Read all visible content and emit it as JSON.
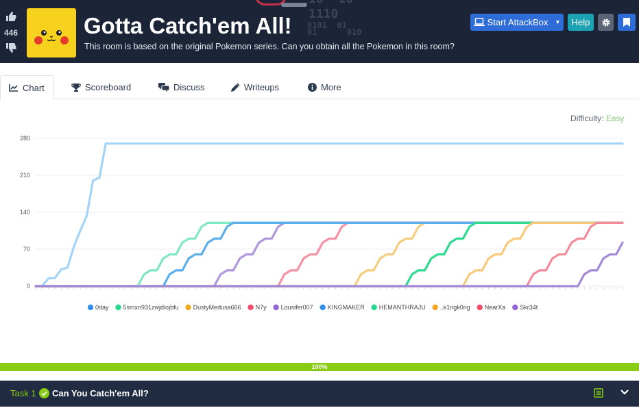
{
  "room": {
    "title": "Gotta Catch'em All!",
    "subtitle": "This room is based on the original Pokemon series. Can you obtain all the Pokemon in this room?",
    "votes": "446",
    "deco_lines": [
      "10  10",
      "1110",
      "0101  01",
      "01      010"
    ],
    "icon": "pikachu-face"
  },
  "header_buttons": {
    "attackbox_label": "Start AttackBox",
    "help_label": "Help",
    "settings_icon": "gear-icon",
    "bookmark_icon": "bookmark-icon"
  },
  "tabs": [
    {
      "label": "Chart",
      "icon": "chart-line-icon"
    },
    {
      "label": "Scoreboard",
      "icon": "trophy-icon"
    },
    {
      "label": "Discuss",
      "icon": "comments-icon"
    },
    {
      "label": "Writeups",
      "icon": "pen-icon"
    },
    {
      "label": "More",
      "icon": "info-icon"
    }
  ],
  "difficulty": {
    "label": "Difficulty:",
    "value": "Easy",
    "color": "#8cc97a"
  },
  "chart_data": {
    "type": "line",
    "title": "",
    "xlabel": "",
    "ylabel": "",
    "ylim": [
      0,
      280
    ],
    "yticks": [
      0,
      70,
      140,
      210,
      280
    ],
    "grid": true,
    "legend_position": "bottom",
    "series": [
      {
        "name": "0day",
        "color": "#a3d4f7",
        "start": 0.4,
        "end": 270,
        "steps": [
          0,
          15,
          35,
          105,
          200,
          270
        ],
        "ramp_start_index": 1
      },
      {
        "name": "5smxn931zwjdiojbfu",
        "color": "#7fe8c3",
        "start": 0,
        "end": 120,
        "steps": [
          0,
          30,
          60,
          90,
          120
        ],
        "ramp_start_index": 16
      },
      {
        "name": "DustyMedusa666",
        "color": "#f5cd7f",
        "start": 0,
        "end": 120,
        "steps": [
          0,
          30,
          60,
          90,
          120
        ],
        "ramp_start_index": 50
      },
      {
        "name": "N7y",
        "color": "#f492a4",
        "start": 0,
        "end": 120,
        "steps": [
          0,
          30,
          60,
          90,
          120
        ],
        "ramp_start_index": 38
      },
      {
        "name": "Lousifer007",
        "color": "#b097de",
        "start": 0,
        "end": 120,
        "steps": [
          0,
          30,
          60,
          90,
          120
        ],
        "ramp_start_index": 28
      },
      {
        "name": "KINGMAKER",
        "color": "#5aaeec",
        "start": 0,
        "end": 120,
        "steps": [
          0,
          30,
          60,
          90,
          120
        ],
        "ramp_start_index": 20
      },
      {
        "name": "HEMANTHRAJU",
        "color": "#2fd98d",
        "start": 0,
        "end": 120,
        "steps": [
          0,
          30,
          60,
          90,
          120
        ],
        "ramp_start_index": 58
      },
      {
        "name": "..k1ngk0ng",
        "color": "#f9c97b",
        "start": 0,
        "end": 120,
        "steps": [
          0,
          30,
          60,
          90,
          120
        ],
        "ramp_start_index": 67
      },
      {
        "name": "NearXa",
        "color": "#f48b9a",
        "start": 0,
        "end": 120,
        "steps": [
          0,
          30,
          60,
          90,
          120
        ],
        "ramp_start_index": 77
      },
      {
        "name": "Skr34t",
        "color": "#a38ad8",
        "start": 0,
        "end": 120,
        "steps": [
          0,
          30,
          60,
          90,
          120
        ],
        "ramp_start_index": 85
      }
    ],
    "x_count": 93,
    "legend_dot_colors": [
      "#2f91ec",
      "#29d68e",
      "#f3a823",
      "#f24d6b",
      "#9367d6",
      "#2f91ec",
      "#29d68e",
      "#f3a823",
      "#f24d6b",
      "#9367d6"
    ]
  },
  "progress": {
    "value": 100,
    "label": "100%"
  },
  "task": {
    "number": "Task 1",
    "title": "Can You Catch'em All?",
    "status_icon": "check-circle-icon",
    "list_icon": "list-icon",
    "toggle_icon": "chevron-down-icon"
  }
}
